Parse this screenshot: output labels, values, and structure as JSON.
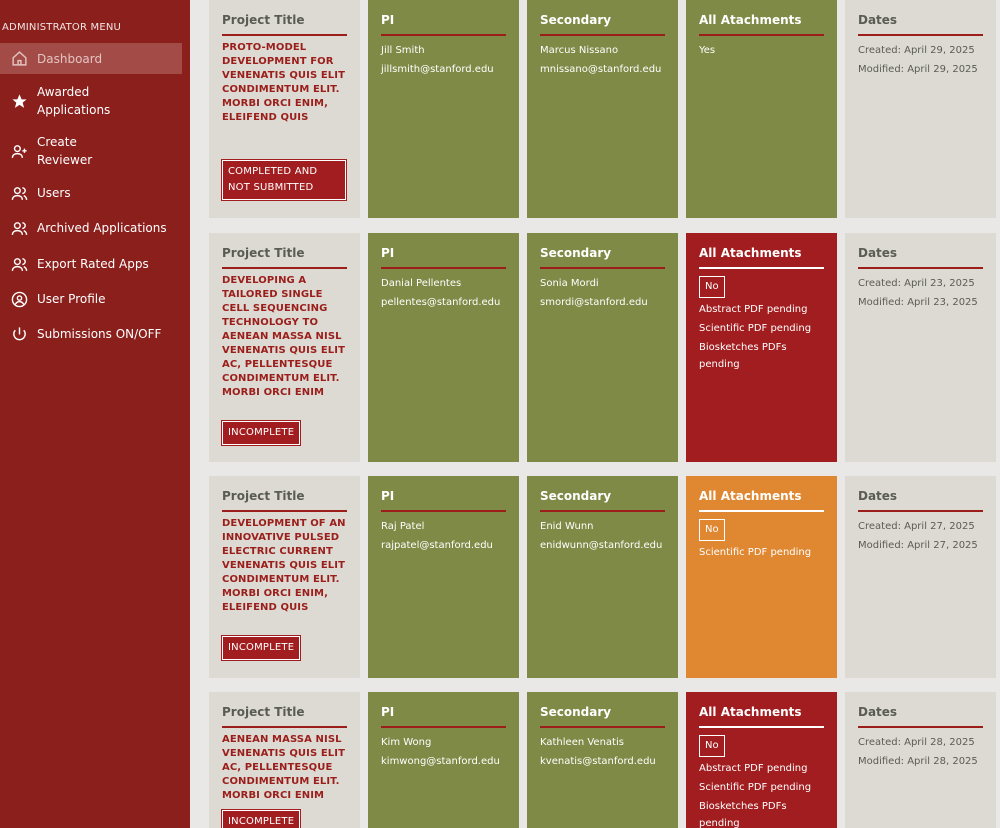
{
  "sidebar": {
    "title": "ADMINISTRATOR MENU",
    "items": [
      {
        "label": "Dashboard",
        "icon": "home-icon"
      },
      {
        "label": "Awarded Applications",
        "icon": "star-icon"
      },
      {
        "label": "Create Reviewer",
        "icon": "add-user-icon"
      },
      {
        "label": "Users",
        "icon": "users-icon"
      },
      {
        "label": "Archived Applications",
        "icon": "users-icon"
      },
      {
        "label": "Export Rated Apps",
        "icon": "users-icon"
      },
      {
        "label": "User Profile",
        "icon": "user-circle-icon"
      },
      {
        "label": "Submissions ON/OFF",
        "icon": "power-icon"
      }
    ]
  },
  "headers": {
    "project_title": "Project Title",
    "pi": "PI",
    "secondary": "Secondary",
    "attachments": "All Atachments",
    "dates": "Dates"
  },
  "applications": [
    {
      "project_title": "PROTO-MODEL DEVELOPMENT FOR VENENATIS QUIS ELIT CONDIMENTUM ELIT. MORBI ORCI ENIM, ELEIFEND QUIS",
      "status": "COMPLETED AND NOT SUBMITTED",
      "pi_name": "Jill Smith",
      "pi_email": "jillsmith@stanford.edu",
      "secondary_name": "Marcus Nissano",
      "secondary_email": "mnissano@stanford.edu",
      "attachments": "Yes",
      "attachments_color": "#7e8a46",
      "pending": [],
      "created": "Created: April 29, 2025",
      "modified": "Modified: April 29, 2025"
    },
    {
      "project_title": "DEVELOPING A TAILORED SINGLE CELL SEQUENCING TECHNOLOGY TO AENEAN MASSA NISL VENENATIS QUIS ELIT AC, PELLENTESQUE CONDIMENTUM ELIT. MORBI ORCI ENIM",
      "status": "INCOMPLETE",
      "pi_name": "Danial Pellentes",
      "pi_email": "pellentes@stanford.edu",
      "secondary_name": "Sonia Mordi",
      "secondary_email": "smordi@stanford.edu",
      "attachments": "No",
      "attachments_color": "#a11d1f",
      "pending": [
        "Abstract PDF pending",
        "Scientific PDF pending",
        "Biosketches PDFs pending"
      ],
      "created": "Created: April 23, 2025",
      "modified": "Modified: April 23, 2025"
    },
    {
      "project_title": "DEVELOPMENT OF AN INNOVATIVE PULSED ELECTRIC CURRENT VENENATIS QUIS ELIT CONDIMENTUM ELIT. MORBI ORCI ENIM, ELEIFEND QUIS",
      "status": "INCOMPLETE",
      "pi_name": "Raj Patel",
      "pi_email": "rajpatel@stanford.edu",
      "secondary_name": "Enid Wunn",
      "secondary_email": "enidwunn@stanford.edu",
      "attachments": "No",
      "attachments_color": "#df8731",
      "pending": [
        "Scientific PDF pending"
      ],
      "created": "Created: April 27, 2025",
      "modified": "Modified: April 27, 2025"
    },
    {
      "project_title": "AENEAN MASSA NISL VENENATIS QUIS ELIT AC, PELLENTESQUE CONDIMENTUM ELIT. MORBI ORCI ENIM",
      "status": "INCOMPLETE",
      "pi_name": "Kim Wong",
      "pi_email": "kimwong@stanford.edu",
      "secondary_name": "Kathleen Venatis",
      "secondary_email": "kvenatis@stanford.edu",
      "attachments": "No",
      "attachments_color": "#a11d1f",
      "pending": [
        "Abstract PDF pending",
        "Scientific PDF pending",
        "Biosketches PDFs pending"
      ],
      "created": "Created: April 28, 2025",
      "modified": "Modified: April 28, 2025"
    }
  ]
}
